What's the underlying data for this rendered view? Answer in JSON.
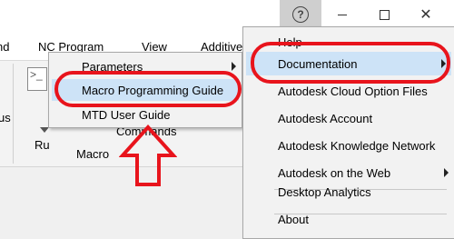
{
  "titlebar": {
    "help_glyph": "?",
    "close_glyph": "✕"
  },
  "ribbon": {
    "tabs": [
      "nd",
      "NC Program",
      "View",
      "Additive"
    ],
    "partial_label_left": "us",
    "partial_label_ru": "Ru",
    "commands_label": "Commands",
    "group_label": "Macro"
  },
  "submenu": {
    "items": [
      {
        "label": "Parameters",
        "has_submenu": true
      },
      {
        "label": "Macro Programming Guide",
        "highlighted": true
      },
      {
        "label": "MTD User Guide"
      }
    ]
  },
  "help_menu": {
    "items": [
      {
        "label": "Help"
      },
      {
        "label": "Documentation",
        "has_submenu": true,
        "highlighted": true
      },
      {
        "label": "Autodesk Cloud Option Files"
      },
      {
        "label": "Autodesk Account"
      },
      {
        "label": "Autodesk Knowledge Network"
      },
      {
        "label": "Autodesk on the Web",
        "has_submenu": true
      },
      {
        "label": "Desktop Analytics"
      },
      {
        "label": "About"
      }
    ]
  },
  "colors": {
    "highlight": "#cde3f7",
    "annotation_red": "#e8141c",
    "menu_bg": "#f2f2f2"
  },
  "icons": [
    "help-icon",
    "minimize-icon",
    "maximize-icon",
    "close-icon",
    "submenu-arrow-icon",
    "dropdown-arrow-icon",
    "up-arrow-annotation"
  ]
}
